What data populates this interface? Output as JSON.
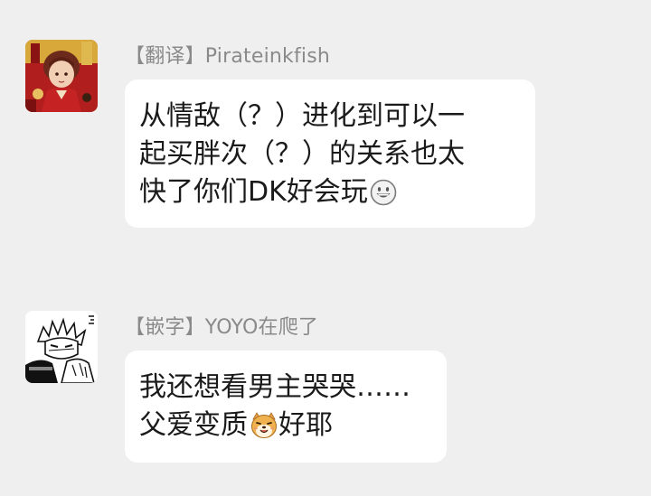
{
  "messages": [
    {
      "sender": "【翻译】Pirateinkfish",
      "avatar_icon": "anime-character-red-costume-avatar",
      "lines": [
        "从情敌（？）进化到可以一",
        "起买胖次（？）的关系也太",
        "快了你们DK好会玩"
      ],
      "emoji_icon": "grinning-face-emoji"
    },
    {
      "sender": "【嵌字】YOYO在爬了",
      "avatar_icon": "manga-sketch-character-avatar",
      "lines": [
        "我还想看男主哭哭……",
        "父爱变质",
        "好耶"
      ],
      "emoji_icon": "shiba-dog-emoji"
    }
  ],
  "colors": {
    "background": "#efefef",
    "bubble": "#ffffff",
    "sender_text": "#8a8a8a",
    "message_text": "#1a1a1a"
  }
}
